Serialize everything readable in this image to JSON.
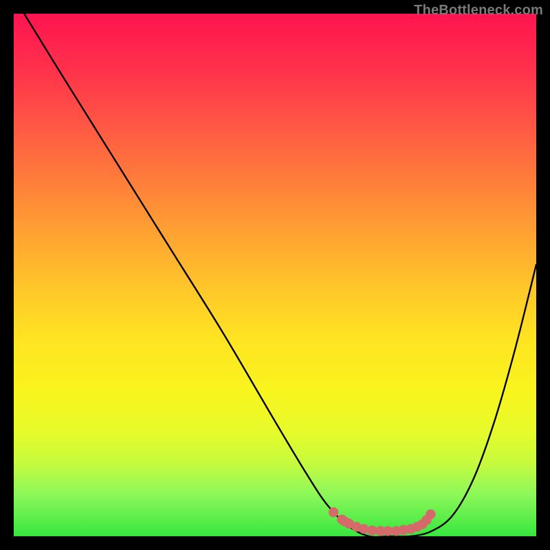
{
  "watermark": "TheBottleneck.com",
  "colors": {
    "background": "#000000",
    "curve": "#000000",
    "markers_fill": "#d46a6a",
    "markers_stroke": "#b94a4a",
    "watermark": "#7a7a7a"
  },
  "chart_data": {
    "type": "line",
    "title": "",
    "xlabel": "",
    "ylabel": "",
    "xlim": [
      0,
      100
    ],
    "ylim": [
      0,
      100
    ],
    "grid": false,
    "legend": false,
    "series": [
      {
        "name": "curve",
        "x": [
          2,
          10,
          20,
          30,
          40,
          50,
          56,
          60,
          64,
          68,
          72,
          76,
          80,
          84,
          88,
          92,
          96,
          100
        ],
        "y": [
          100,
          87,
          71,
          55,
          39,
          22,
          12,
          6,
          2,
          0,
          0,
          0,
          1,
          4,
          11,
          22,
          36,
          52
        ]
      }
    ],
    "markers": {
      "name": "optimal-range",
      "x": [
        61.2,
        62.8,
        63.4,
        64.2,
        65.6,
        67.0,
        68.6,
        70.2,
        71.6,
        73.2,
        74.6,
        76.0,
        77.2,
        78.2,
        79.0,
        79.8
      ],
      "y": [
        4.6,
        3.2,
        2.8,
        2.4,
        1.8,
        1.4,
        1.1,
        1.0,
        1.0,
        1.0,
        1.2,
        1.4,
        1.8,
        2.3,
        3.1,
        4.2
      ]
    }
  }
}
